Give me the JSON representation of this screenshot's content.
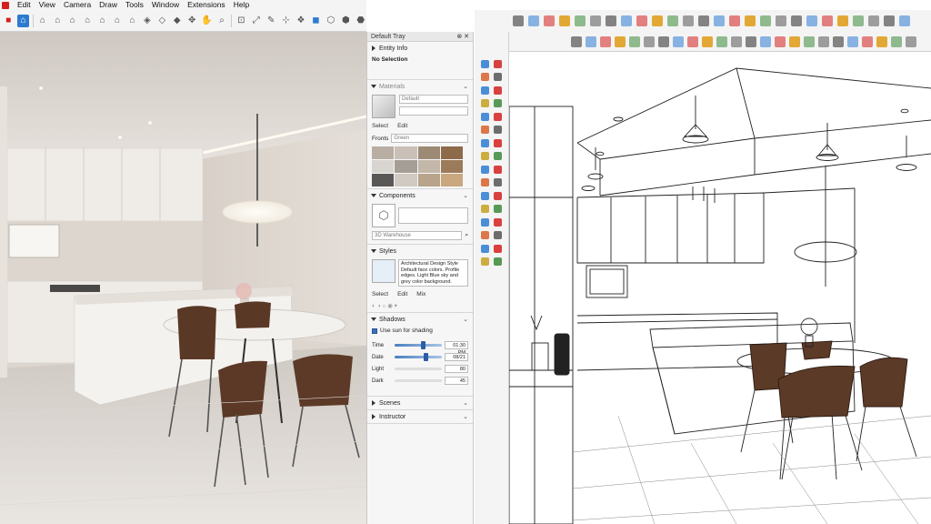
{
  "menu": [
    "Edit",
    "View",
    "Camera",
    "Draw",
    "Tools",
    "Window",
    "Extensions",
    "Help"
  ],
  "tray": {
    "title": "Default Tray",
    "entity_info": {
      "header": "Entity Info",
      "selection": "No Selection"
    },
    "materials": {
      "header": "Materials",
      "name_placeholder": "Default",
      "tabs": [
        "Select",
        "Edit"
      ],
      "library": "Fronts",
      "library_sub": "Green",
      "swatches": [
        "#b9aea3",
        "#c9c1b8",
        "#9c8a75",
        "#8c6a4a",
        "#d8d4cf",
        "#a59e96",
        "#c3b7aa",
        "#9b7b59",
        "#5a5856",
        "#d0cac3",
        "#b7a48b",
        "#c9a77f"
      ]
    },
    "components": {
      "header": "Components",
      "search_placeholder": "3D Warehouse"
    },
    "styles": {
      "header": "Styles",
      "style_name": "Architectural Design Style",
      "style_desc": "Default face colors. Profile edges. Light Blue sky and grey color background.",
      "tabs": [
        "Select",
        "Edit",
        "Mix"
      ]
    },
    "shadows": {
      "header": "Shadows",
      "use_sun": "Use sun for shading",
      "time_label": "Time",
      "time_value": "01:30 PM",
      "date_label": "Date",
      "date_value": "08/21",
      "light_label": "Light",
      "light_value": "80",
      "dark_label": "Dark",
      "dark_value": "45"
    },
    "scenes": {
      "header": "Scenes"
    },
    "instructor": {
      "header": "Instructor"
    }
  },
  "colors": {
    "accent": "#2d7bd1",
    "brand_red": "#d32020"
  }
}
